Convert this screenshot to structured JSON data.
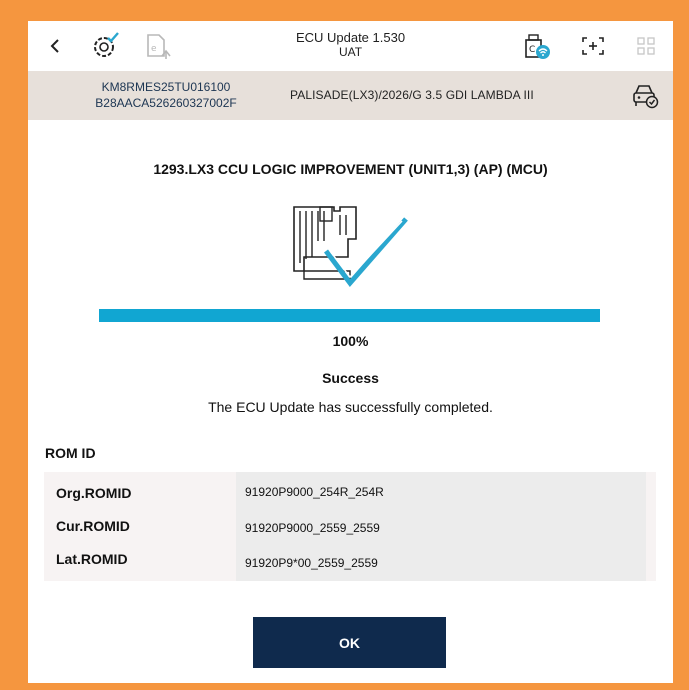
{
  "app": {
    "title": "ECU Update 1.530",
    "environment": "UAT"
  },
  "vehicle": {
    "vin": "KM8RMES25TU016100",
    "software_code": "B28AACA526260327002F",
    "model": "PALISADE(LX3)/2026/G 3.5 GDI LAMBDA III"
  },
  "update": {
    "job_title": "1293.LX3 CCU LOGIC IMPROVEMENT (UNIT1,3) (AP) (MCU)",
    "progress_percent": 100,
    "progress_label": "100%",
    "status": "Success",
    "message": "The ECU Update has successfully completed."
  },
  "rom": {
    "header": "ROM ID",
    "rows": [
      {
        "label": "Org.ROMID",
        "value": "91920P9000_254R_254R"
      },
      {
        "label": "Cur.ROMID",
        "value": "91920P9000_2559_2559"
      },
      {
        "label": "Lat.ROMID",
        "value": "91920P9*00_2559_2559"
      }
    ]
  },
  "buttons": {
    "ok_label": "OK"
  },
  "icons": {
    "back": "back-chevron-icon",
    "diagnostic": "diagnostic-check-icon",
    "e_upload": "e-document-upload-icon",
    "vci_wifi": "vci-wifi-icon",
    "screen_capture": "screen-capture-icon",
    "grid_menu": "grid-menu-icon",
    "car_check": "car-check-icon",
    "ecu_success": "ecu-success-illustration"
  },
  "colors": {
    "frame": "#f5963f",
    "progress": "#11a6d2",
    "ok_button": "#0f2a4d",
    "info_bar": "#e7e0da",
    "vin_text": "#1c3552",
    "check_accent": "#2aa7cf"
  }
}
